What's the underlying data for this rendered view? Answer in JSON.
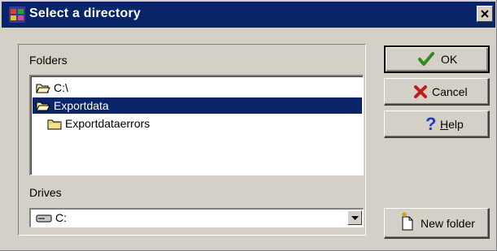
{
  "window": {
    "title": "Select a directory"
  },
  "folders": {
    "label": "Folders",
    "items": [
      {
        "name": "C:\\",
        "icon": "open-folder-icon",
        "selected": false
      },
      {
        "name": "Exportdata",
        "icon": "open-folder-icon",
        "selected": true
      },
      {
        "name": "Exportdataerrors",
        "icon": "closed-folder-icon",
        "selected": false
      }
    ]
  },
  "drives": {
    "label": "Drives",
    "value": "C:",
    "icon": "drive-icon"
  },
  "buttons": {
    "ok": "OK",
    "cancel": "Cancel",
    "help_prefix": "",
    "help_underlined": "H",
    "help_rest": "elp",
    "new_folder": "New folder"
  },
  "colors": {
    "title_bar": "#0a246a",
    "selection": "#0a246a",
    "dialog_bg": "#d4d0c8",
    "ok_check": "#2e8b1e",
    "cancel_x": "#c21a1a",
    "help_q": "#1a3fbf"
  }
}
